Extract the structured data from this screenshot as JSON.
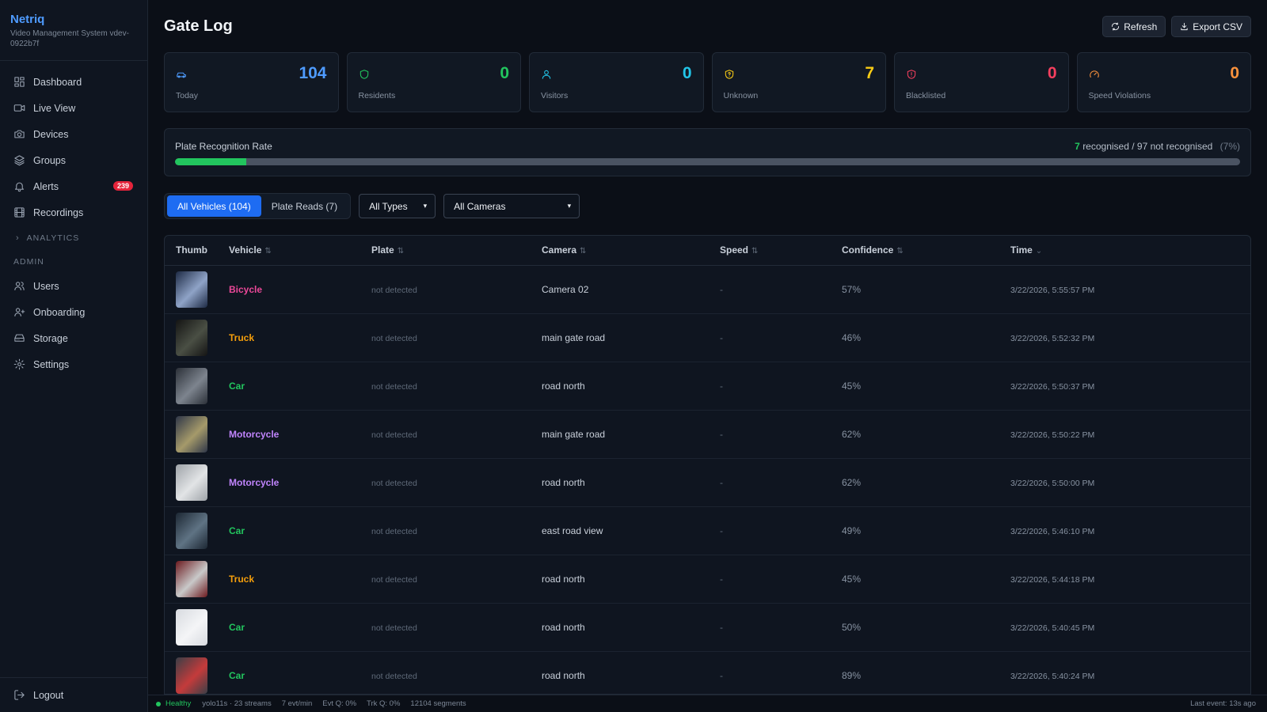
{
  "brand": {
    "name": "Netriq",
    "subtitle": "Video Management System vdev-0922b7f"
  },
  "nav": {
    "items": [
      {
        "label": "Dashboard",
        "icon": "dashboard-icon"
      },
      {
        "label": "Live View",
        "icon": "video-icon"
      },
      {
        "label": "Devices",
        "icon": "camera-icon"
      },
      {
        "label": "Groups",
        "icon": "layers-icon"
      },
      {
        "label": "Alerts",
        "icon": "bell-icon",
        "badge": "239"
      },
      {
        "label": "Recordings",
        "icon": "film-icon"
      }
    ],
    "analytics_label": "ANALYTICS",
    "admin_label": "ADMIN",
    "admin_items": [
      {
        "label": "Users",
        "icon": "users-icon"
      },
      {
        "label": "Onboarding",
        "icon": "user-plus-icon"
      },
      {
        "label": "Storage",
        "icon": "storage-icon"
      },
      {
        "label": "Settings",
        "icon": "gear-icon"
      }
    ],
    "logout_label": "Logout"
  },
  "header": {
    "title": "Gate Log",
    "refresh_label": "Refresh",
    "export_label": "Export CSV"
  },
  "stats": [
    {
      "label": "Today",
      "value": "104",
      "color": "#4e9bff",
      "icon": "car-icon"
    },
    {
      "label": "Residents",
      "value": "0",
      "color": "#22c55e",
      "icon": "shield-icon"
    },
    {
      "label": "Visitors",
      "value": "0",
      "color": "#22c5e8",
      "icon": "user-icon"
    },
    {
      "label": "Unknown",
      "value": "7",
      "color": "#facc15",
      "icon": "shield-question-icon"
    },
    {
      "label": "Blacklisted",
      "value": "0",
      "color": "#f43f5e",
      "icon": "shield-alert-icon"
    },
    {
      "label": "Speed Violations",
      "value": "0",
      "color": "#fb923c",
      "icon": "gauge-icon"
    }
  ],
  "recognition": {
    "title": "Plate Recognition Rate",
    "recognised": "7",
    "recognised_text": "recognised /",
    "not_recognised_text": "97 not recognised",
    "percent_text": "(7%)",
    "rate": 0.067
  },
  "filters": {
    "tabs": [
      "All Vehicles (104)",
      "Plate Reads (7)"
    ],
    "active_tab": 0,
    "type_select": "All Types",
    "camera_select": "All Cameras"
  },
  "table": {
    "headers": [
      "Thumb",
      "Vehicle",
      "Plate",
      "Camera",
      "Speed",
      "Confidence",
      "Time"
    ],
    "rows": [
      {
        "vehicle": "Bicycle",
        "color": "#ec4899",
        "plate": "not detected",
        "camera": "Camera 02",
        "speed": "-",
        "confidence": "57%",
        "time": "3/22/2026, 5:55:57 PM",
        "thumb": [
          "#1d2a44",
          "#8fa3c7"
        ]
      },
      {
        "vehicle": "Truck",
        "color": "#f59e0b",
        "plate": "not detected",
        "camera": "main gate road",
        "speed": "-",
        "confidence": "46%",
        "time": "3/22/2026, 5:52:32 PM",
        "thumb": [
          "#141414",
          "#4a4f44"
        ]
      },
      {
        "vehicle": "Car",
        "color": "#22c55e",
        "plate": "not detected",
        "camera": "road north",
        "speed": "-",
        "confidence": "45%",
        "time": "3/22/2026, 5:50:37 PM",
        "thumb": [
          "#2b3038",
          "#7d848e"
        ]
      },
      {
        "vehicle": "Motorcycle",
        "color": "#c084fc",
        "plate": "not detected",
        "camera": "main gate road",
        "speed": "-",
        "confidence": "62%",
        "time": "3/22/2026, 5:50:22 PM",
        "thumb": [
          "#2e3648",
          "#a59a6a"
        ]
      },
      {
        "vehicle": "Motorcycle",
        "color": "#c084fc",
        "plate": "not detected",
        "camera": "road north",
        "speed": "-",
        "confidence": "62%",
        "time": "3/22/2026, 5:50:00 PM",
        "thumb": [
          "#9ea3a8",
          "#e2e4e6"
        ]
      },
      {
        "vehicle": "Car",
        "color": "#22c55e",
        "plate": "not detected",
        "camera": "east road view",
        "speed": "-",
        "confidence": "49%",
        "time": "3/22/2026, 5:46:10 PM",
        "thumb": [
          "#1c2733",
          "#5f7384"
        ]
      },
      {
        "vehicle": "Truck",
        "color": "#f59e0b",
        "plate": "not detected",
        "camera": "road north",
        "speed": "-",
        "confidence": "45%",
        "time": "3/22/2026, 5:44:18 PM",
        "thumb": [
          "#6b1a1f",
          "#c9c9c9"
        ]
      },
      {
        "vehicle": "Car",
        "color": "#22c55e",
        "plate": "not detected",
        "camera": "road north",
        "speed": "-",
        "confidence": "50%",
        "time": "3/22/2026, 5:40:45 PM",
        "thumb": [
          "#d8dbe0",
          "#f4f5f7"
        ]
      },
      {
        "vehicle": "Car",
        "color": "#22c55e",
        "plate": "not detected",
        "camera": "road north",
        "speed": "-",
        "confidence": "89%",
        "time": "3/22/2026, 5:40:24 PM",
        "thumb": [
          "#3a3f47",
          "#c43b3b"
        ]
      }
    ]
  },
  "footer": {
    "status": "Healthy",
    "model": "yolo11s · 23 streams",
    "rate": "7 evt/min",
    "evt_q": "Evt Q: 0%",
    "trk_q": "Trk Q: 0%",
    "segments": "12104 segments",
    "last_event": "Last event: 13s ago"
  }
}
